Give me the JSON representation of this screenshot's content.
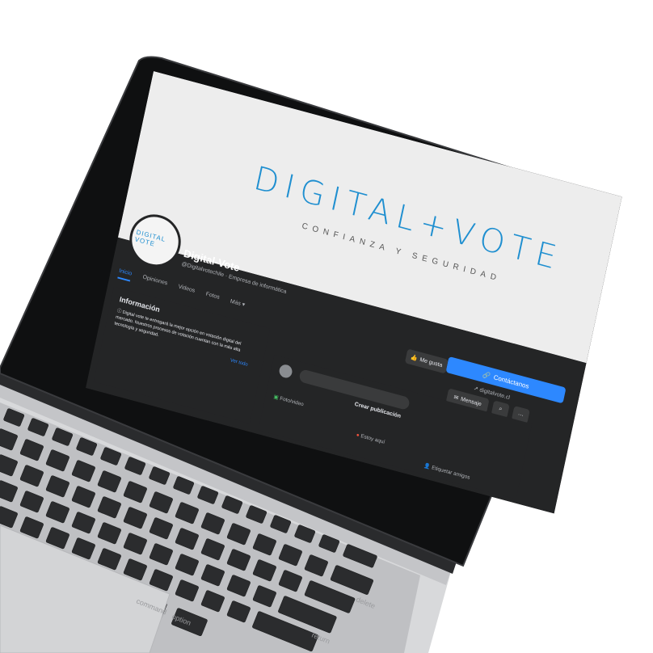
{
  "cover": {
    "logo_text": "DIGITAL+VOTE",
    "tagline": "CONFIANZA Y SEGURIDAD"
  },
  "profile": {
    "avatar_text": "DIGITAL VOTE",
    "name": "Digital-Vote",
    "handle": "@Digitalvotechile · Empresa de informática"
  },
  "tabs": [
    "Inicio",
    "Opiniones",
    "Videos",
    "Fotos",
    "Más ▾"
  ],
  "actions": {
    "contact": "Contáctanos",
    "website": "digitalvote.cl",
    "like": "Me gusta",
    "message": "Mensaje",
    "search_icon": "search-icon",
    "more": "···"
  },
  "info": {
    "title": "Información",
    "text": "Digital vote te entregará la mejor opción en votación digital del mercado. Nuestros procesos de votación cuentan con la más alta tecnología y seguridad.",
    "see_all": "Ver todo"
  },
  "create_post": {
    "title": "Crear publicación",
    "photo": "Foto/video",
    "checkin": "Estoy aquí",
    "tag": "Etiquetar amigos"
  },
  "keyboard": {
    "keys": [
      "command",
      "option",
      "return",
      "delete"
    ]
  },
  "colors": {
    "accent": "#2d88ff",
    "logo_blue": "#1f8fd0",
    "fb_dark": "#242526"
  }
}
